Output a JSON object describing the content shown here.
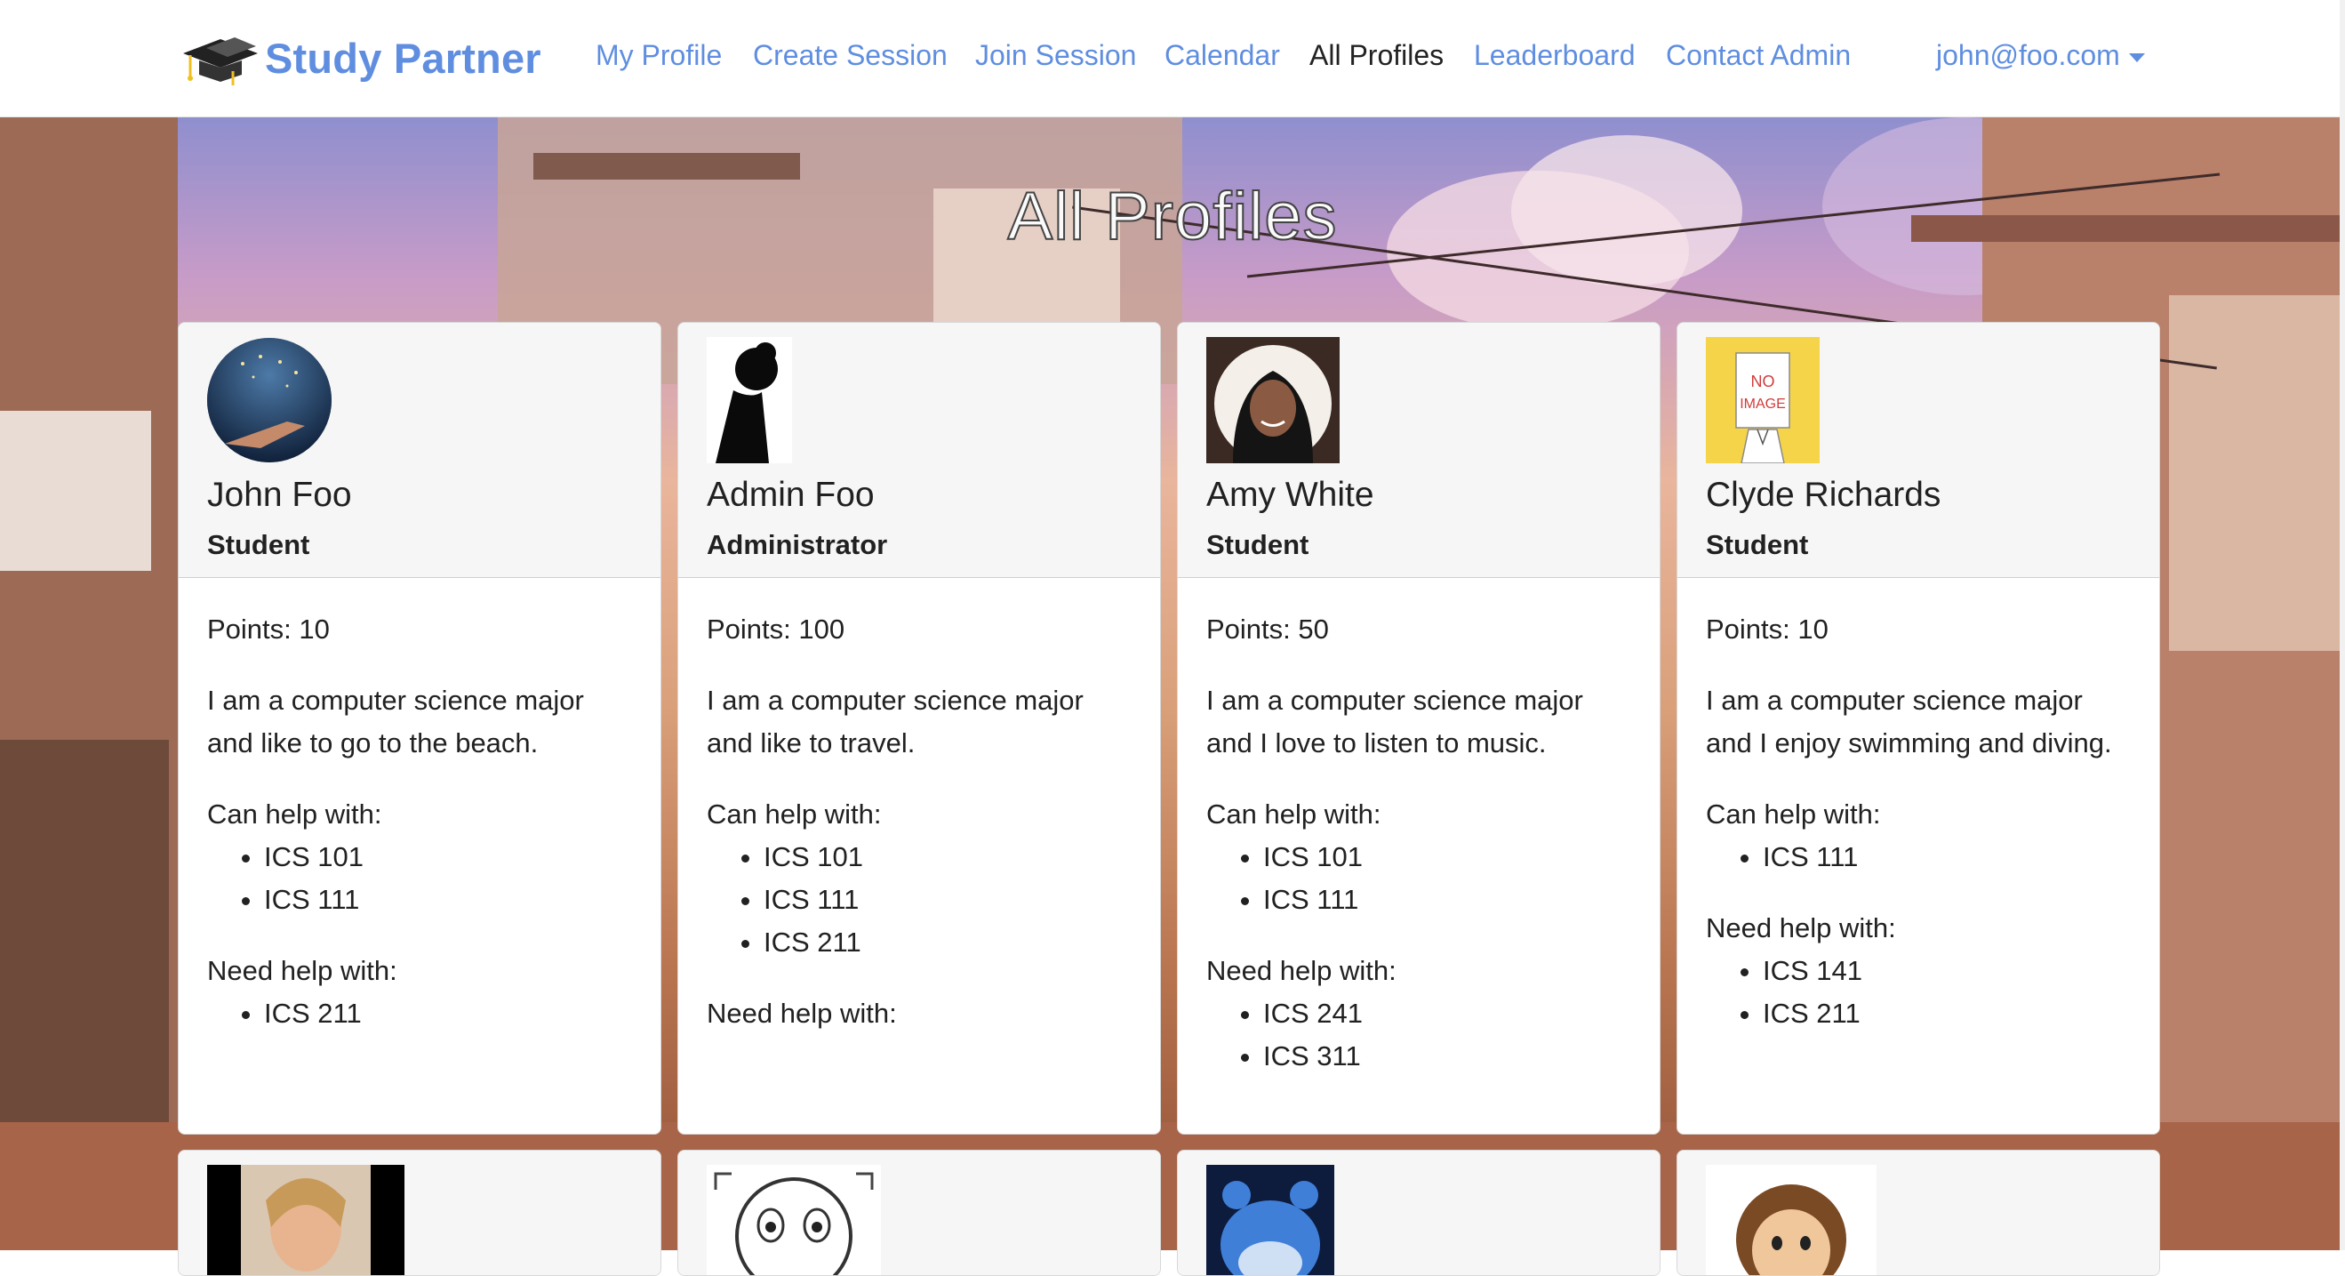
{
  "navbar": {
    "brand": "Study Partner",
    "links": [
      {
        "label": "My Profile",
        "active": false
      },
      {
        "label": "Create Session",
        "active": false
      },
      {
        "label": "Join Session",
        "active": false
      },
      {
        "label": "Calendar",
        "active": false
      },
      {
        "label": "All Profiles",
        "active": true
      },
      {
        "label": "Leaderboard",
        "active": false
      },
      {
        "label": "Contact Admin",
        "active": false
      }
    ],
    "user_email": "john@foo.com"
  },
  "page": {
    "title": "All Profiles"
  },
  "colors": {
    "link": "#5f8ee0",
    "active_link": "#222222",
    "card_header_bg": "#f6f6f6"
  },
  "profiles": [
    {
      "name": "John Foo",
      "role": "Student",
      "points_label": "Points: 10",
      "bio": "I am a computer science major and like to go to the beach.",
      "can_help_label": "Can help with:",
      "can_help": [
        "ICS 101",
        "ICS 111"
      ],
      "need_help_label": "Need help with:",
      "need_help": [
        "ICS 211"
      ]
    },
    {
      "name": "Admin Foo",
      "role": "Administrator",
      "points_label": "Points: 100",
      "bio": "I am a computer science major and like to travel.",
      "can_help_label": "Can help with:",
      "can_help": [
        "ICS 101",
        "ICS 111",
        "ICS 211"
      ],
      "need_help_label": "Need help with:",
      "need_help": []
    },
    {
      "name": "Amy White",
      "role": "Student",
      "points_label": "Points: 50",
      "bio": "I am a computer science major and I love to listen to music.",
      "can_help_label": "Can help with:",
      "can_help": [
        "ICS 101",
        "ICS 111"
      ],
      "need_help_label": "Need help with:",
      "need_help": [
        "ICS 241",
        "ICS 311"
      ]
    },
    {
      "name": "Clyde Richards",
      "role": "Student",
      "points_label": "Points: 10",
      "bio": "I am a computer science major and I enjoy swimming and diving.",
      "can_help_label": "Can help with:",
      "can_help": [
        "ICS 111"
      ],
      "need_help_label": "Need help with:",
      "need_help": [
        "ICS 141",
        "ICS 211"
      ]
    }
  ],
  "no_image_text": "NO IMAGE"
}
